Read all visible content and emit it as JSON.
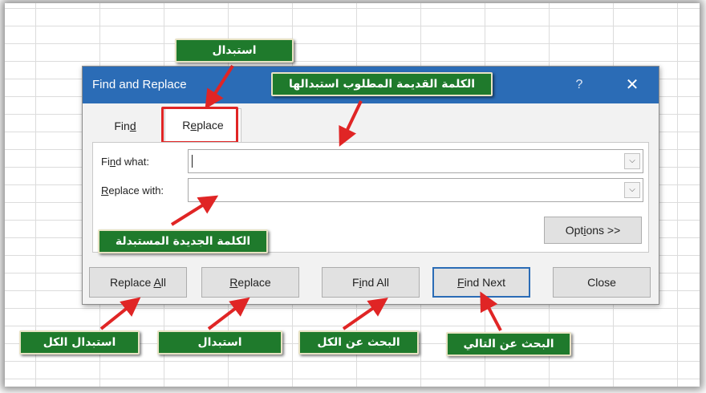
{
  "dialog": {
    "title": "Find and Replace",
    "help": "?",
    "close_glyph": "✕",
    "tabs": {
      "find": "Find",
      "replace": "Replace"
    },
    "find_what": {
      "label": "Find what:",
      "value": ""
    },
    "replace_with": {
      "label": "Replace with:",
      "value": ""
    },
    "options_button": "Options >>",
    "buttons": {
      "replace_all": "Replace All",
      "replace": "Replace",
      "find_all": "Find All",
      "find_next": "Find Next",
      "close": "Close"
    }
  },
  "callouts": {
    "replace_tab": "استبدال",
    "old_word": "الكلمة القديمة المطلوب استبدالها",
    "new_word": "الكلمة الجديدة المستبدلة",
    "replace_all": "استبدال الكل",
    "replace": "استبدال",
    "find_all": "البحث عن الكل",
    "find_next": "البحث عن التالي"
  },
  "colors": {
    "title_bar": "#2b6cb6",
    "callout_bg": "#1f7a2c",
    "arrow": "#e02525"
  }
}
